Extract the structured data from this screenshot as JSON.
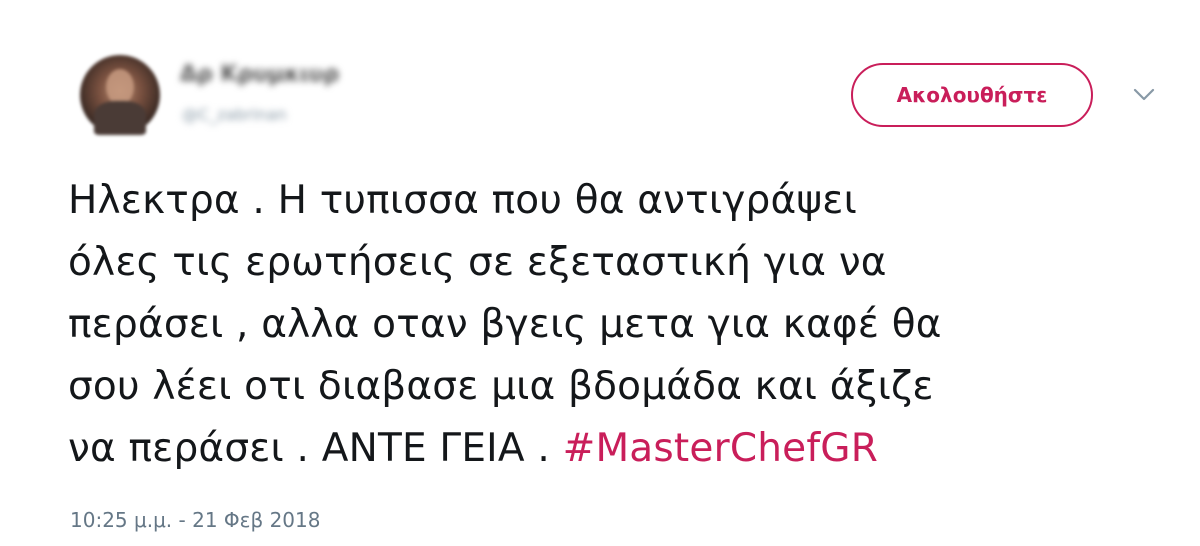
{
  "user": {
    "display_name": "Δρ Κρυμκιυρ",
    "handle": "@C_zabrinan"
  },
  "follow_button": {
    "label": "Ακολουθήστε"
  },
  "menu": {
    "icon": "chevron-down-icon"
  },
  "tweet": {
    "lines": [
      "Ηλεκτρα . Η τυπισσα που θα αντιγράψει",
      "όλες τις ερωτήσεις σε εξεταστική για να",
      "περάσει , αλλα οταν βγεις μετα για καφέ θα",
      "σου λέει οτι διαβασε μια βδομάδα και άξιζε"
    ],
    "last_line_text": "να περάσει . ΑΝΤΕ ΓΕΙΑ . ",
    "hashtag": "#MasterChefGR",
    "timestamp": "10:25 μ.μ. - 21 Φεβ 2018"
  },
  "colors": {
    "accent": "#c91e5a",
    "text": "#14171a",
    "muted": "#657786"
  }
}
